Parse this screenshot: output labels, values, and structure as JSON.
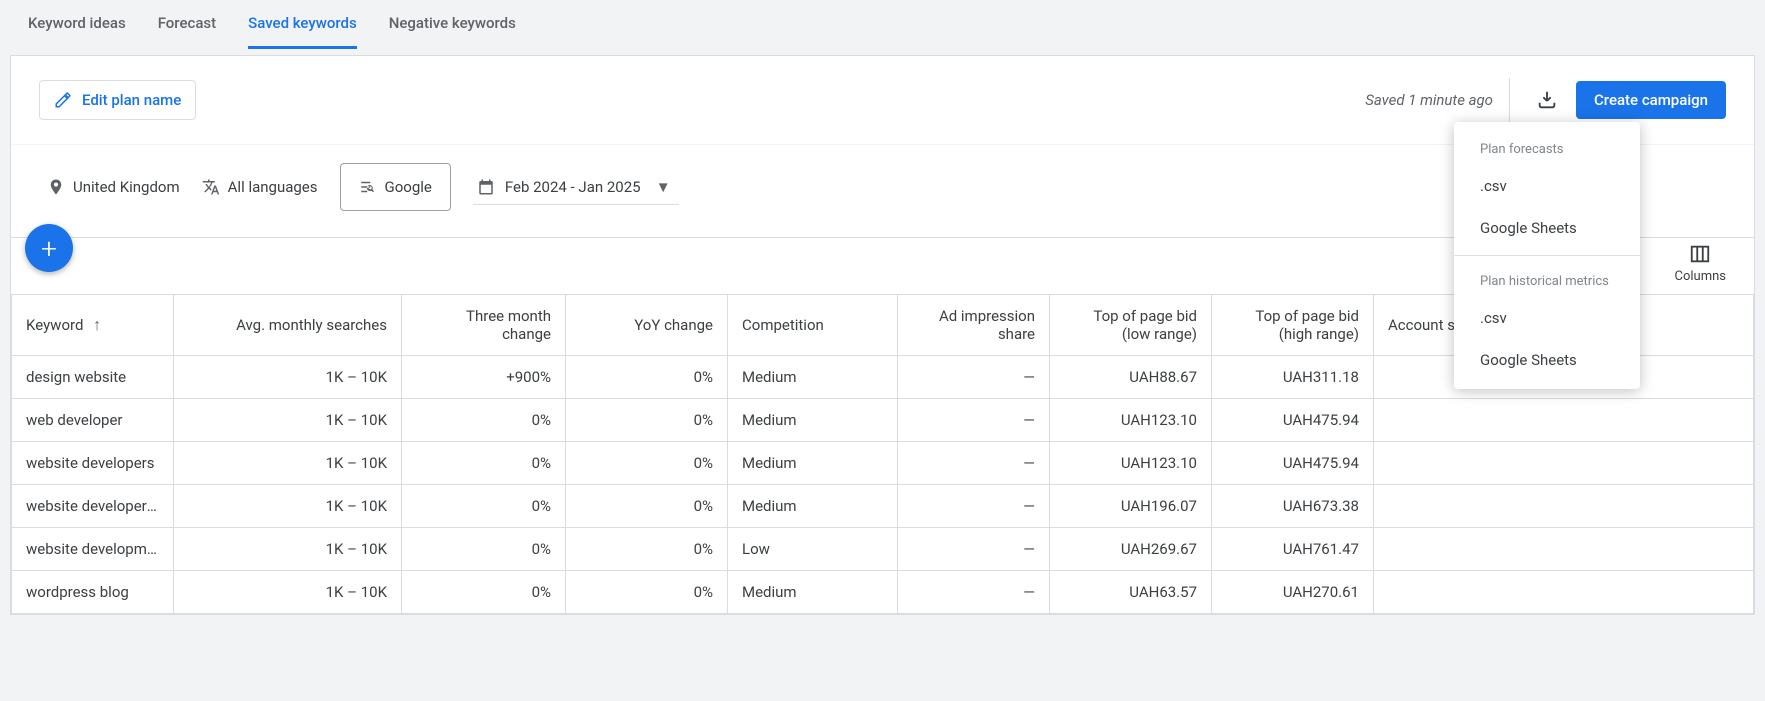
{
  "tabs": [
    "Keyword ideas",
    "Forecast",
    "Saved keywords",
    "Negative keywords"
  ],
  "activeTabIndex": 2,
  "editPlanLabel": "Edit plan name",
  "savedStatus": "Saved 1 minute ago",
  "createCampaignLabel": "Create campaign",
  "filters": {
    "location": "United Kingdom",
    "language": "All languages",
    "network": "Google",
    "dateRange": "Feb 2024 - Jan 2025"
  },
  "columnsLabel": "Columns",
  "dropdown": {
    "section1": "Plan forecasts",
    "csv": ".csv",
    "sheets": "Google Sheets",
    "section2": "Plan historical metrics"
  },
  "headers": {
    "keyword": "Keyword",
    "avg": "Avg. monthly searches",
    "tmc": "Three month change",
    "yoy": "YoY change",
    "comp": "Competition",
    "imp": "Ad impression share",
    "bidLow": "Top of page bid (low range)",
    "bidHigh": "Top of page bid (high range)",
    "status": "Account status"
  },
  "rows": [
    {
      "kw": "design website",
      "avg": "1K – 10K",
      "tmc": "+900%",
      "yoy": "0%",
      "comp": "Medium",
      "imp": "—",
      "bidLow": "UAH88.67",
      "bidHigh": "UAH311.18"
    },
    {
      "kw": "web developer",
      "avg": "1K – 10K",
      "tmc": "0%",
      "yoy": "0%",
      "comp": "Medium",
      "imp": "—",
      "bidLow": "UAH123.10",
      "bidHigh": "UAH475.94"
    },
    {
      "kw": "website developers",
      "avg": "1K – 10K",
      "tmc": "0%",
      "yoy": "0%",
      "comp": "Medium",
      "imp": "—",
      "bidLow": "UAH123.10",
      "bidHigh": "UAH475.94"
    },
    {
      "kw": "website developers n…",
      "avg": "1K – 10K",
      "tmc": "0%",
      "yoy": "0%",
      "comp": "Medium",
      "imp": "—",
      "bidLow": "UAH196.07",
      "bidHigh": "UAH673.38"
    },
    {
      "kw": "website developmen…",
      "avg": "1K – 10K",
      "tmc": "0%",
      "yoy": "0%",
      "comp": "Low",
      "imp": "—",
      "bidLow": "UAH269.67",
      "bidHigh": "UAH761.47"
    },
    {
      "kw": "wordpress blog",
      "avg": "1K – 10K",
      "tmc": "0%",
      "yoy": "0%",
      "comp": "Medium",
      "imp": "—",
      "bidLow": "UAH63.57",
      "bidHigh": "UAH270.61"
    }
  ]
}
